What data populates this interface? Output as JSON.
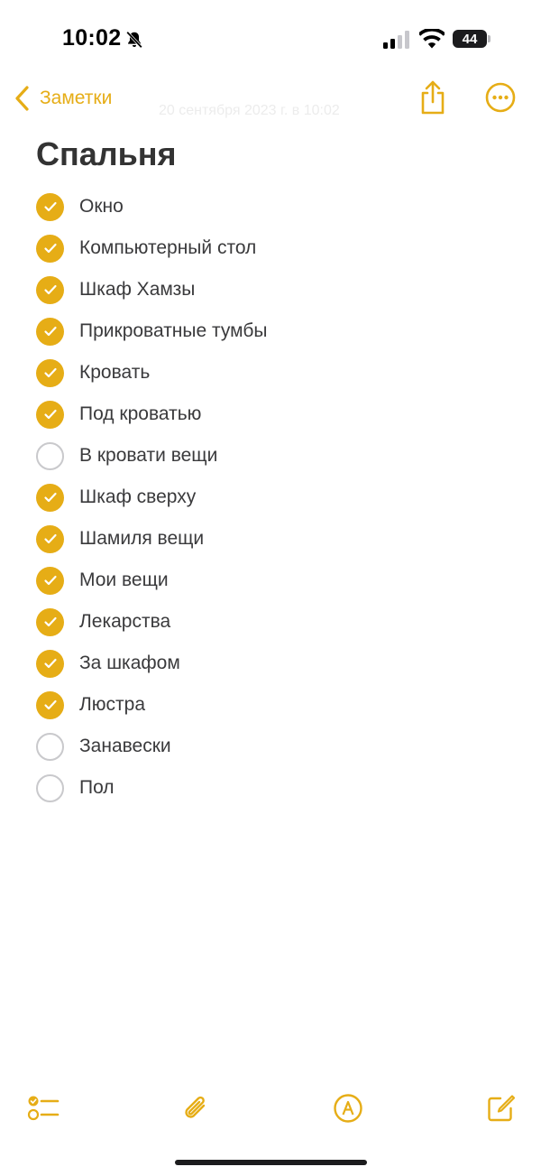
{
  "status_bar": {
    "time": "10:02",
    "battery": "44",
    "icons": [
      "bell-slash-icon",
      "cellular-signal-icon",
      "wifi-icon",
      "battery-icon"
    ]
  },
  "nav": {
    "back_label": "Заметки",
    "subtitle": "20 сентября 2023 г. в 10:02",
    "icons": [
      "chevron-left-icon",
      "share-icon",
      "more-icon"
    ]
  },
  "note": {
    "title": "Спальня",
    "items": [
      {
        "label": "Окно",
        "checked": true
      },
      {
        "label": "Компьютерный стол",
        "checked": true
      },
      {
        "label": "Шкаф Хамзы",
        "checked": true
      },
      {
        "label": "Прикроватные тумбы",
        "checked": true
      },
      {
        "label": "Кровать",
        "checked": true
      },
      {
        "label": "Под кроватью",
        "checked": true
      },
      {
        "label": "В кровати вещи",
        "checked": false
      },
      {
        "label": "Шкаф сверху",
        "checked": true
      },
      {
        "label": "Шамиля вещи",
        "checked": true
      },
      {
        "label": "Мои вещи",
        "checked": true
      },
      {
        "label": "Лекарства",
        "checked": true
      },
      {
        "label": "За шкафом",
        "checked": true
      },
      {
        "label": "Люстра",
        "checked": true
      },
      {
        "label": "Занавески",
        "checked": false
      },
      {
        "label": "Пол",
        "checked": false
      }
    ]
  },
  "toolbar": {
    "icons": [
      "checklist-icon",
      "paperclip-icon",
      "markup-pen-icon",
      "compose-icon"
    ]
  },
  "colors": {
    "accent": "#e6ad16",
    "unchecked_border": "#c9c9cc",
    "text": "#3a3a3c"
  }
}
